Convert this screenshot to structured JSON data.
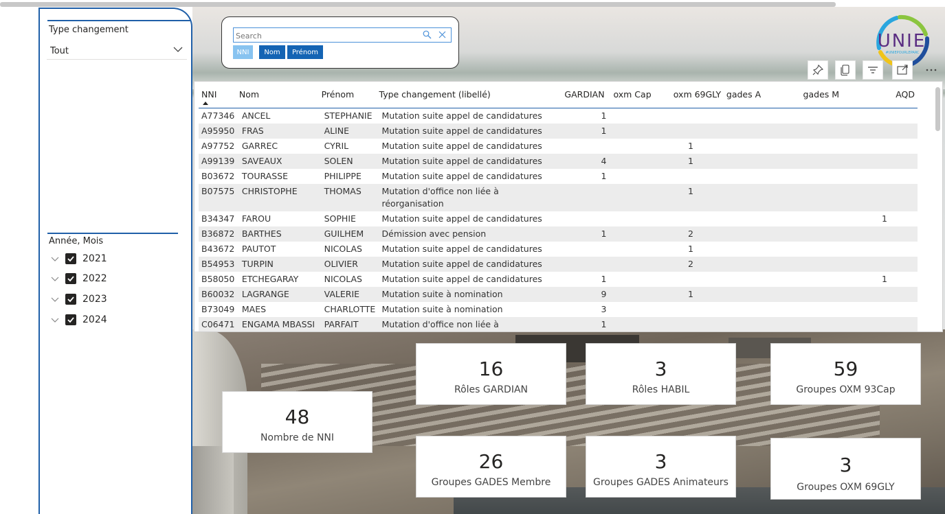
{
  "slicers": {
    "type_changement": {
      "title": "Type changement",
      "selected": "Tout"
    },
    "annee_mois": {
      "title": "Année, Mois",
      "items": [
        {
          "label": "2021",
          "checked": true
        },
        {
          "label": "2022",
          "checked": true
        },
        {
          "label": "2023",
          "checked": true
        },
        {
          "label": "2024",
          "checked": true
        }
      ]
    }
  },
  "search": {
    "placeholder": "Search",
    "fields": [
      "NNI",
      "Nom",
      "Prénom"
    ]
  },
  "logo": {
    "text": "UNIE",
    "tagline": "#UNIEPOURLEPARC"
  },
  "visual_header": [
    "pin-icon",
    "copy-icon",
    "filter-icon",
    "focus-mode-icon",
    "more-options-icon"
  ],
  "table": {
    "columns": [
      "NNI",
      "Nom",
      "Prénom",
      "Type changement (libellé)",
      "GARDIAN",
      "oxm Cap",
      "oxm 69GLY",
      "gades A",
      "gades M",
      "AQD"
    ],
    "rows": [
      [
        "A77346",
        "ANCEL",
        "STEPHANIE",
        "Mutation suite appel de candidatures",
        "1",
        "",
        "",
        "",
        "",
        ""
      ],
      [
        "A95950",
        "FRAS",
        "ALINE",
        "Mutation suite appel de candidatures",
        "1",
        "",
        "",
        "",
        "",
        ""
      ],
      [
        "A97752",
        "GARREC",
        "CYRIL",
        "Mutation suite appel de candidatures",
        "",
        "",
        "1",
        "",
        "",
        ""
      ],
      [
        "A99139",
        "SAVEAUX",
        "SOLEN",
        "Mutation suite appel de candidatures",
        "4",
        "",
        "1",
        "",
        "",
        ""
      ],
      [
        "B03672",
        "TOURASSE",
        "PHILIPPE",
        "Mutation suite appel de candidatures",
        "1",
        "",
        "",
        "",
        "",
        ""
      ],
      [
        "B07575",
        "CHRISTOPHE",
        "THOMAS",
        "Mutation d'office non liée à réorganisation",
        "",
        "",
        "1",
        "",
        "",
        ""
      ],
      [
        "B34347",
        "FAROU",
        "SOPHIE",
        "Mutation suite appel de candidatures",
        "",
        "",
        "",
        "",
        "",
        "1"
      ],
      [
        "B36872",
        "BARTHES",
        "GUILHEM",
        "Démission avec pension",
        "1",
        "",
        "2",
        "",
        "",
        ""
      ],
      [
        "B43672",
        "PAUTOT",
        "NICOLAS",
        "Mutation suite appel de candidatures",
        "",
        "",
        "1",
        "",
        "",
        ""
      ],
      [
        "B54953",
        "TURPIN",
        "OLIVIER",
        "Mutation suite appel de candidatures",
        "",
        "",
        "2",
        "",
        "",
        ""
      ],
      [
        "B58050",
        "ETCHEGARAY",
        "NICOLAS",
        "Mutation suite appel de candidatures",
        "1",
        "",
        "",
        "",
        "",
        "1"
      ],
      [
        "B60032",
        "LAGRANGE",
        "VALERIE",
        "Mutation suite à nomination",
        "9",
        "",
        "1",
        "",
        "",
        ""
      ],
      [
        "B73049",
        "MAES",
        "CHARLOTTE",
        "Mutation suite à nomination",
        "3",
        "",
        "",
        "",
        "",
        ""
      ],
      [
        "C06471",
        "ENGAMA MBASSI",
        "PARFAIT",
        "Mutation d'office non liée à",
        "1",
        "",
        "",
        "",
        "",
        ""
      ]
    ]
  },
  "cards": {
    "nni": {
      "value": "48",
      "label": "Nombre de NNI"
    },
    "gardian": {
      "value": "16",
      "label": "Rôles GARDIAN"
    },
    "habil": {
      "value": "3",
      "label": "Rôles HABIL"
    },
    "oxm93": {
      "value": "59",
      "label": "Groupes OXM 93Cap"
    },
    "gades_membre": {
      "value": "26",
      "label": "Groupes GADES Membre"
    },
    "gades_anim": {
      "value": "3",
      "label": "Groupes GADES Animateurs"
    },
    "oxm69": {
      "value": "3",
      "label": "Groupes OXM 69GLY"
    }
  },
  "colors": {
    "accent": "#1f5fa8",
    "button_active": "#1464b4",
    "button_light": "#88c3f0",
    "row_alt": "#ececec"
  }
}
